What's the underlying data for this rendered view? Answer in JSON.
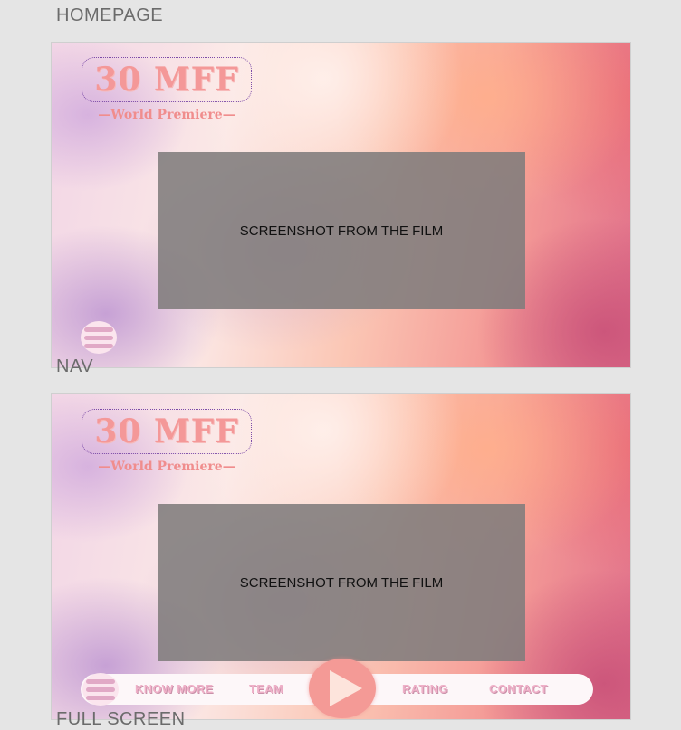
{
  "labels": {
    "homepage": "HOMEPAGE",
    "nav": "NAV",
    "fullscreen": "FULL SCREEN"
  },
  "logo": {
    "title": "30 MFF",
    "subtitle": "—World Premiere—"
  },
  "screenshot_placeholder": "SCREENSHOT FROM THE FILM",
  "nav": {
    "items": [
      "KNOW MORE",
      "TEAM",
      "RATING",
      "CONTACT"
    ]
  },
  "icons": {
    "menu": "hamburger-menu-icon",
    "play": "play-icon"
  },
  "colors": {
    "logo": "#f49898",
    "accent": "#f49a96",
    "nav_text": "#efb0c8",
    "placeholder_bg": "#807c7c"
  }
}
